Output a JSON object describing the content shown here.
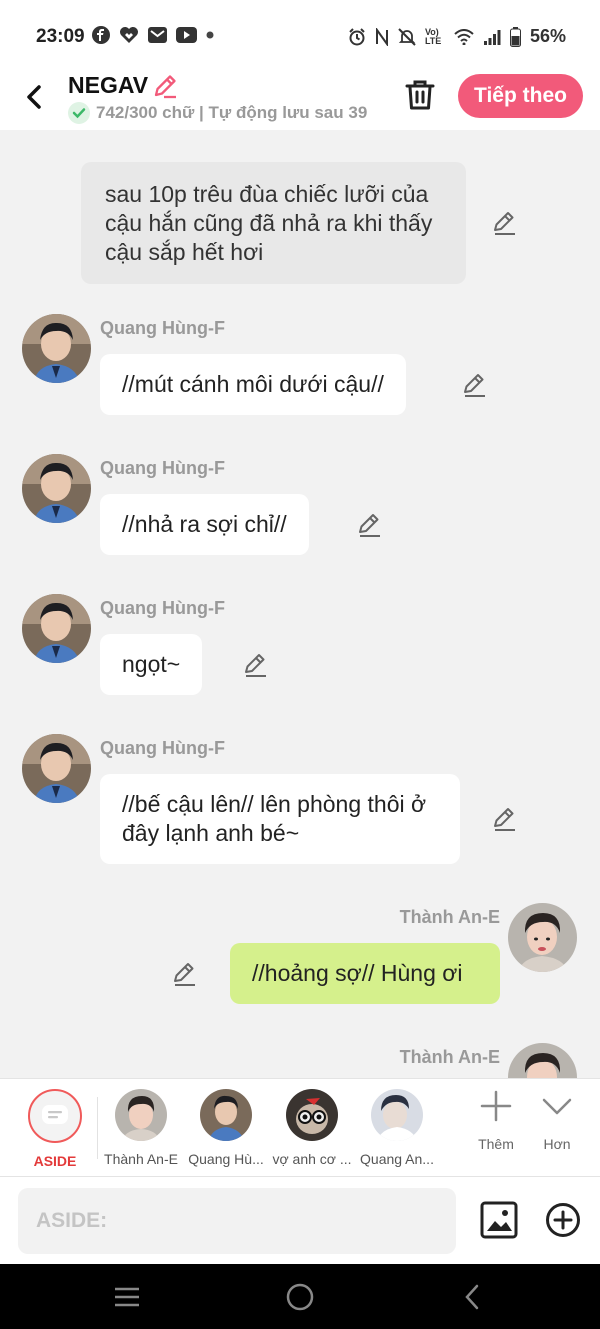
{
  "status_bar": {
    "time": "23:09",
    "battery": "56%",
    "icons_left": [
      "facebook-icon",
      "heart-app-icon",
      "mail-icon",
      "youtube-icon",
      "dot-icon"
    ],
    "icons_right": [
      "alarm-icon",
      "nfc-icon",
      "mute-icon",
      "volte-icon",
      "wifi-icon",
      "signal-icon",
      "battery-icon"
    ],
    "volte_label": "Vo) LTE"
  },
  "header": {
    "title": "NEGAV",
    "subtitle": "742/300 chữ | Tự động lưu sau 39",
    "next_label": "Tiếp theo"
  },
  "narration": "sau 10p trêu đùa chiếc lưỡi của cậu hắn cũng đã nhả ra khi thấy cậu sắp hết hơi",
  "messages": [
    {
      "name": "Quang Hùng-F",
      "text": "//mút cánh môi dưới cậu//"
    },
    {
      "name": "Quang Hùng-F",
      "text": "//nhả ra sợi chỉ//"
    },
    {
      "name": "Quang Hùng-F",
      "text": "ngọt~"
    },
    {
      "name": "Quang Hùng-F",
      "text": "//bế cậu lên// lên phòng thôi ở đây lạnh anh bé~"
    },
    {
      "name": "Thành An-E",
      "text": "//hoảng sợ// Hùng ơi"
    },
    {
      "name": "Thành An-E",
      "text": ""
    }
  ],
  "characters": [
    {
      "label": "ASIDE"
    },
    {
      "label": "Thành An-E"
    },
    {
      "label": "Quang Hù..."
    },
    {
      "label": "vợ anh cơ ..."
    },
    {
      "label": "Quang An..."
    }
  ],
  "tools": {
    "add_label": "Thêm",
    "more_label": "Hơn"
  },
  "input": {
    "placeholder": "ASIDE:"
  },
  "colors": {
    "accent": "#f25a7a",
    "my_bubble": "#d5f08c",
    "aside_red": "#e33a3a"
  }
}
